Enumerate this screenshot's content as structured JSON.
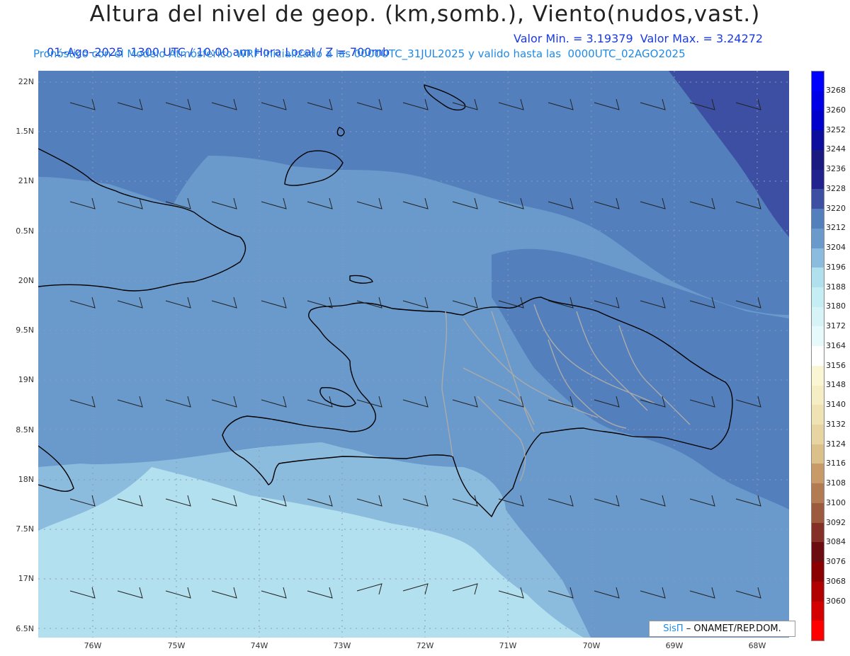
{
  "header": {
    "title": "Altura del nivel de geop. (km,somb.), Viento(nudos,vast.)",
    "line1_left": "01–Ago–2025  1300 UTC / 10:00 am Hora Local / Z = 700mb",
    "line1_right": "Valor Min. = 3.19379  Valor Max. = 3.24272",
    "line2": "Pronóstico con el Modelo Atmósferico WRF inicializado a las 0000UTC_31JUL2025 y valido hasta las  0000UTC_02AGO2025"
  },
  "axes": {
    "lat_labels": [
      "22N",
      "1.5N",
      "21N",
      "0.5N",
      "20N",
      "9.5N",
      "19N",
      "8.5N",
      "18N",
      "7.5N",
      "17N",
      "6.5N"
    ],
    "lon_labels": [
      "76W",
      "75W",
      "74W",
      "73W",
      "72W",
      "71W",
      "70W",
      "69W",
      "68W"
    ]
  },
  "colorbar": {
    "labels": [
      "3268",
      "3260",
      "3252",
      "3244",
      "3236",
      "3228",
      "3220",
      "3212",
      "3204",
      "3196",
      "3188",
      "3180",
      "3172",
      "3164",
      "3156",
      "3148",
      "3140",
      "3132",
      "3124",
      "3116",
      "3108",
      "3100",
      "3092",
      "3084",
      "3076",
      "3068",
      "3060"
    ],
    "colors": [
      "#0000ff",
      "#0000e6",
      "#0000cc",
      "#0d0d9e",
      "#1a1a80",
      "#22228f",
      "#3d4fa3",
      "#5380bd",
      "#6a9acb",
      "#8bbbdd",
      "#b0e0ee",
      "#c4eef4",
      "#d6f4f8",
      "#e6fafc",
      "#ffffff",
      "#faf5d2",
      "#f5eec5",
      "#efe3b4",
      "#e8d4a0",
      "#dcc08a",
      "#c89a68",
      "#b27b52",
      "#9c5a3e",
      "#843026",
      "#6b0d10",
      "#8a0000",
      "#b00000",
      "#d40000",
      "#ff0000"
    ]
  },
  "map": {
    "fill_colors": {
      "lowest": "#b3e0ef",
      "low": "#8bbbdd",
      "mid": "#6a9acb",
      "high": "#5380bd",
      "highest": "#3d4fa3"
    },
    "wind_barbs": "NE trade winds 10-20 kt"
  },
  "credit": {
    "brand": "SisΠ",
    "text": " – ONAMET/REP.DOM."
  }
}
